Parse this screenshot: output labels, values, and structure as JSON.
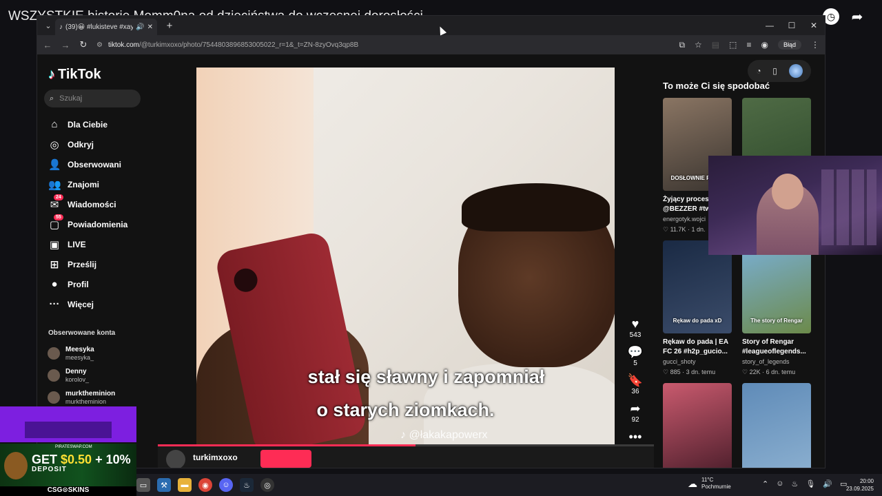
{
  "stream": {
    "title": "WSZYSTKIE historie Momm0na od dzieciństwa do wczesnej dorosłości",
    "top_icons": [
      "clock-icon",
      "share-icon"
    ]
  },
  "browser": {
    "tab": {
      "title": "(39)😀 #lukisteve #xayooin",
      "audio_icon": "🔊",
      "close": "✕"
    },
    "new_tab": "+",
    "window_controls": [
      "—",
      "☐",
      "✕"
    ],
    "url_host": "tiktok.com",
    "url_path": "/@turkimxoxo/photo/7544803896853005022_r=1&_t=ZN-8zyOvq3qp8B",
    "error_button": "Błąd"
  },
  "tiktok": {
    "logo": "TikTok",
    "search_placeholder": "Szukaj",
    "nav": [
      {
        "label": "Dla Ciebie",
        "icon": "⌂"
      },
      {
        "label": "Odkryj",
        "icon": "◎"
      },
      {
        "label": "Obserwowani",
        "icon": "👤"
      },
      {
        "label": "Znajomi",
        "icon": "👥"
      },
      {
        "label": "Wiadomości",
        "icon": "✉",
        "badge": "24"
      },
      {
        "label": "Powiadomienia",
        "icon": "▢",
        "badge": "55"
      },
      {
        "label": "LIVE",
        "icon": "▣"
      },
      {
        "label": "Prześlij",
        "icon": "⊞"
      },
      {
        "label": "Profil",
        "icon": "●"
      },
      {
        "label": "Więcej",
        "icon": "···"
      }
    ],
    "followed_title": "Obserwowane konta",
    "followed": [
      {
        "name": "Meesyka",
        "handle": "meesyka_"
      },
      {
        "name": "Denny",
        "handle": "korolov_"
      },
      {
        "name": "murktheminion",
        "handle": "murktheminion"
      }
    ],
    "video": {
      "subtitle_1": "stał się sławny i zapomniał",
      "subtitle_2": "o starych ziomkach.",
      "watermark": "@łakakapowerx",
      "progress": 0.52
    },
    "actions": [
      {
        "name": "like",
        "icon": "♥",
        "count": "543"
      },
      {
        "name": "comment",
        "icon": "💬",
        "count": "5"
      },
      {
        "name": "save",
        "icon": "🔖",
        "count": "36"
      },
      {
        "name": "share",
        "icon": "➦",
        "count": "92"
      },
      {
        "name": "more",
        "icon": "•••",
        "count": ""
      }
    ],
    "author": "turkimxoxo",
    "recs_title": "To może Ci się spodobać",
    "recs": [
      {
        "caption": "Żyjący proces @BEZZER #tw",
        "user": "energotyk.wojci",
        "likes": "11.7K",
        "age": "1 dn.",
        "thumb_text": "DOSŁOWNIE POW...",
        "color1": "#8a7563",
        "color2": "#3b3530"
      },
      {
        "caption": "",
        "user": "",
        "likes": "",
        "age": "",
        "thumb_text": "",
        "color1": "#4f6b45",
        "color2": "#2e4a2b"
      },
      {
        "caption": "Rękaw do pada | EA FC 26 #h2p_gucio...",
        "user": "gucci_shoty",
        "likes": "885",
        "age": "3 dn. temu",
        "thumb_text": "Rękaw do pada xD",
        "color1": "#1a2a44",
        "color2": "#3b4c6a"
      },
      {
        "caption": "Story of Rengar #leagueoflegends...",
        "user": "story_of_legends",
        "likes": "22K",
        "age": "6 dn. temu",
        "thumb_text": "The story of Rengar",
        "color1": "#7ab0d9",
        "color2": "#6c8a4a"
      },
      {
        "caption": "",
        "user": "",
        "likes": "",
        "age": "",
        "thumb_text": "",
        "color1": "#c95a6e",
        "color2": "#4a1d2a"
      },
      {
        "caption": "",
        "user": "",
        "likes": "",
        "age": "",
        "thumb_text": "",
        "color1": "#5f8bb8",
        "color2": "#8cb0d0"
      }
    ]
  },
  "ads": {
    "small": "PIRATESWAP.COM",
    "headline_a": "GET ",
    "headline_b": "$0.50",
    "headline_c": " + 10%",
    "sub": "DEPOSIT",
    "brand": "CSG⊙SKINS"
  },
  "taskbar": {
    "weather_temp": "11°C",
    "weather_desc": "Pochmurnie",
    "time": "20:00",
    "date": "23.09.2025"
  }
}
